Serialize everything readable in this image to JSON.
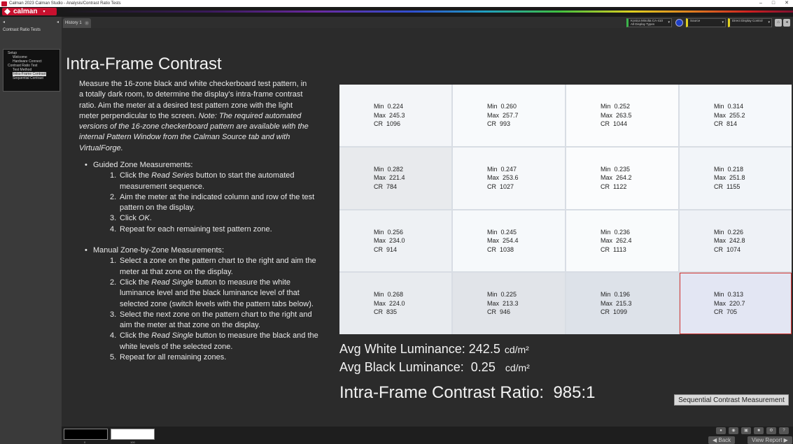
{
  "window": {
    "title": "Calman 2023 Calman Studio - Analysis/Contrast Ratio Tests",
    "minimize": "–",
    "maximize": "□",
    "close": "✕"
  },
  "menu": {
    "logo": "calman",
    "logo_caret": "▾"
  },
  "sidebar": {
    "collapse": "◂",
    "pin": "◂",
    "title": "Contrast Ratio Tests",
    "tree": [
      {
        "label": "Setup",
        "level": 0
      },
      {
        "label": "Welcome",
        "level": 2
      },
      {
        "label": "Hardware Connect",
        "level": 2
      },
      {
        "label": "Contrast Ratio Test",
        "level": 0
      },
      {
        "label": "Test Method",
        "level": 2
      },
      {
        "label": "Intra-Frame Contrast",
        "level": 2,
        "selected": true
      },
      {
        "label": "Sequential Contrast",
        "level": 2
      }
    ]
  },
  "tabs": {
    "history": "History 1",
    "close": "×"
  },
  "toolbar": {
    "meter_line1": "Konica Minolta CA-410",
    "meter_line2": "All Display Types",
    "meter_dd": "▾",
    "source": "Source",
    "source_dd": "▾",
    "display": "Direct Display Control",
    "display_dd": "▾",
    "btn_home": "⌂",
    "btn_more": "◂"
  },
  "page": {
    "title": "Intra-Frame Contrast",
    "description": "Measure the 16-zone black and white checkerboard test pattern, in a totally dark room, to determine the display's intra-frame contrast ratio. Aim the meter at a desired test pattern zone with the light meter perpendicular to the screen.",
    "note": "Note: The required automated versions of the 16-zone checkerboard pattern are available with the internal Pattern Window from the Calman Source tab and with VirtualForge.",
    "guided_title": "Guided Zone Measurements:",
    "guided_steps": [
      {
        "n": "1.",
        "pre": "Click the ",
        "em": "Read Series",
        "post": " button to start the automated measurement sequence."
      },
      {
        "n": "2.",
        "pre": "Aim the meter at the indicated column and row of the test pattern on the display.",
        "em": "",
        "post": ""
      },
      {
        "n": "3.",
        "pre": "Click ",
        "em": "OK",
        "post": "."
      },
      {
        "n": "4.",
        "pre": "Repeat for each remaining test pattern zone.",
        "em": "",
        "post": ""
      }
    ],
    "manual_title": "Manual Zone-by-Zone Measurements:",
    "manual_steps": [
      {
        "n": "1.",
        "pre": "Select a zone on the pattern chart to the right and aim the meter at that zone on the display.",
        "em": "",
        "post": ""
      },
      {
        "n": "2.",
        "pre": "Click the ",
        "em": "Read Single",
        "post": " button to measure the white luminance level and the black luminance level of that selected zone (switch levels with the pattern tabs below)."
      },
      {
        "n": "3.",
        "pre": "Select the next zone on the pattern chart to the right and aim the meter at that zone on the display.",
        "em": "",
        "post": ""
      },
      {
        "n": "4.",
        "pre": "Click the ",
        "em": "Read Single",
        "post": " button to measure the black and the white levels of the selected zone."
      },
      {
        "n": "5.",
        "pre": "Repeat for all remaining zones.",
        "em": "",
        "post": ""
      }
    ]
  },
  "grid": {
    "labels": {
      "min": "Min",
      "max": "Max",
      "cr": "CR"
    },
    "selected_index": 15,
    "cells": [
      {
        "min": "0.224",
        "max": "245.3",
        "cr": "1096",
        "shade": "#f3f5f8"
      },
      {
        "min": "0.260",
        "max": "257.7",
        "cr": "993",
        "shade": "#f8fafc"
      },
      {
        "min": "0.252",
        "max": "263.5",
        "cr": "1044",
        "shade": "#fbfcfd"
      },
      {
        "min": "0.314",
        "max": "255.2",
        "cr": "814",
        "shade": "#f5f8fb"
      },
      {
        "min": "0.282",
        "max": "221.4",
        "cr": "784",
        "shade": "#e8eaed"
      },
      {
        "min": "0.247",
        "max": "253.6",
        "cr": "1027",
        "shade": "#f6f8fa"
      },
      {
        "min": "0.235",
        "max": "264.2",
        "cr": "1122",
        "shade": "#fbfcfd"
      },
      {
        "min": "0.218",
        "max": "251.8",
        "cr": "1155",
        "shade": "#f2f5f9"
      },
      {
        "min": "0.256",
        "max": "234.0",
        "cr": "914",
        "shade": "#eef1f4"
      },
      {
        "min": "0.245",
        "max": "254.4",
        "cr": "1038",
        "shade": "#f6f9fb"
      },
      {
        "min": "0.236",
        "max": "262.4",
        "cr": "1113",
        "shade": "#f9fbfc"
      },
      {
        "min": "0.226",
        "max": "242.8",
        "cr": "1074",
        "shade": "#eef1f6"
      },
      {
        "min": "0.268",
        "max": "224.0",
        "cr": "835",
        "shade": "#e8ebef"
      },
      {
        "min": "0.225",
        "max": "213.3",
        "cr": "946",
        "shade": "#e1e4e9"
      },
      {
        "min": "0.196",
        "max": "215.3",
        "cr": "1099",
        "shade": "#dde2e9"
      },
      {
        "min": "0.313",
        "max": "220.7",
        "cr": "705",
        "shade": "#e3e6f3"
      }
    ]
  },
  "results": {
    "avg_white_label": "Avg White Luminance:",
    "avg_white_value": "242.5",
    "avg_black_label": "Avg Black Luminance:",
    "avg_black_value": "0.25",
    "unit": "cd/m²",
    "ratio_label": "Intra-Frame Contrast Ratio:",
    "ratio_value": "985:1",
    "seq_button": "Sequential Contrast Measurement"
  },
  "bottom": {
    "swatch_black_label": "0",
    "swatch_white_label": "100",
    "back": "Back",
    "view_report": "View Report"
  },
  "colors": {
    "brand": "#c8102e",
    "selected_zone_border": "#d0312d"
  }
}
